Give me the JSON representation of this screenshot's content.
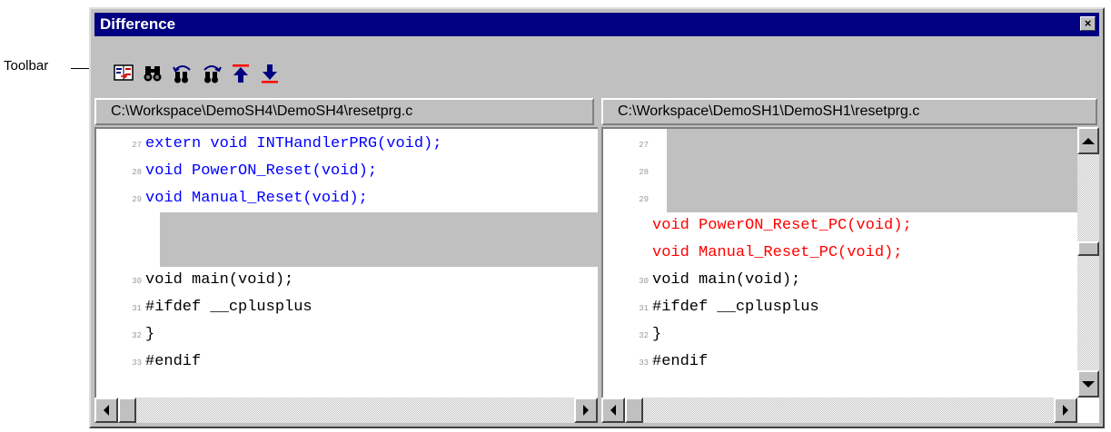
{
  "window": {
    "title": "Difference",
    "close_glyph": "×"
  },
  "callout": {
    "label": "Toolbar"
  },
  "toolbar": {
    "buttons": [
      {
        "name": "compare-icon"
      },
      {
        "name": "find-icon"
      },
      {
        "name": "find-previous-icon"
      },
      {
        "name": "find-next-icon"
      },
      {
        "name": "previous-difference-icon"
      },
      {
        "name": "next-difference-icon"
      }
    ]
  },
  "left_pane": {
    "path": "C:\\Workspace\\DemoSH4\\DemoSH4\\resetprg.c",
    "lines": [
      {
        "num": "27",
        "text": "extern void INTHandlerPRG(void);"
      },
      {
        "num": "28",
        "text": "void PowerON_Reset(void);"
      },
      {
        "num": "29",
        "text": "void Manual_Reset(void);"
      },
      {
        "num": "30",
        "text": "void main(void);"
      },
      {
        "num": "31",
        "text": "#ifdef __cplusplus"
      },
      {
        "num": "32",
        "text": "}"
      },
      {
        "num": "33",
        "text": "#endif"
      }
    ]
  },
  "right_pane": {
    "path": "C:\\Workspace\\DemoSH1\\DemoSH1\\resetprg.c",
    "lines": [
      {
        "num": "27",
        "text": ""
      },
      {
        "num": "28",
        "text": ""
      },
      {
        "num": "29",
        "text": ""
      },
      {
        "num": "",
        "text": "void PowerON_Reset_PC(void);"
      },
      {
        "num": "",
        "text": "void Manual_Reset_PC(void);"
      },
      {
        "num": "30",
        "text": "void main(void);"
      },
      {
        "num": "31",
        "text": "#ifdef __cplusplus"
      },
      {
        "num": "32",
        "text": "}"
      },
      {
        "num": "33",
        "text": "#endif"
      }
    ]
  },
  "colors": {
    "title_bar": "#000080",
    "changed_left": "#0000ff",
    "changed_right": "#ff0000",
    "gap": "#c0c0c0"
  }
}
